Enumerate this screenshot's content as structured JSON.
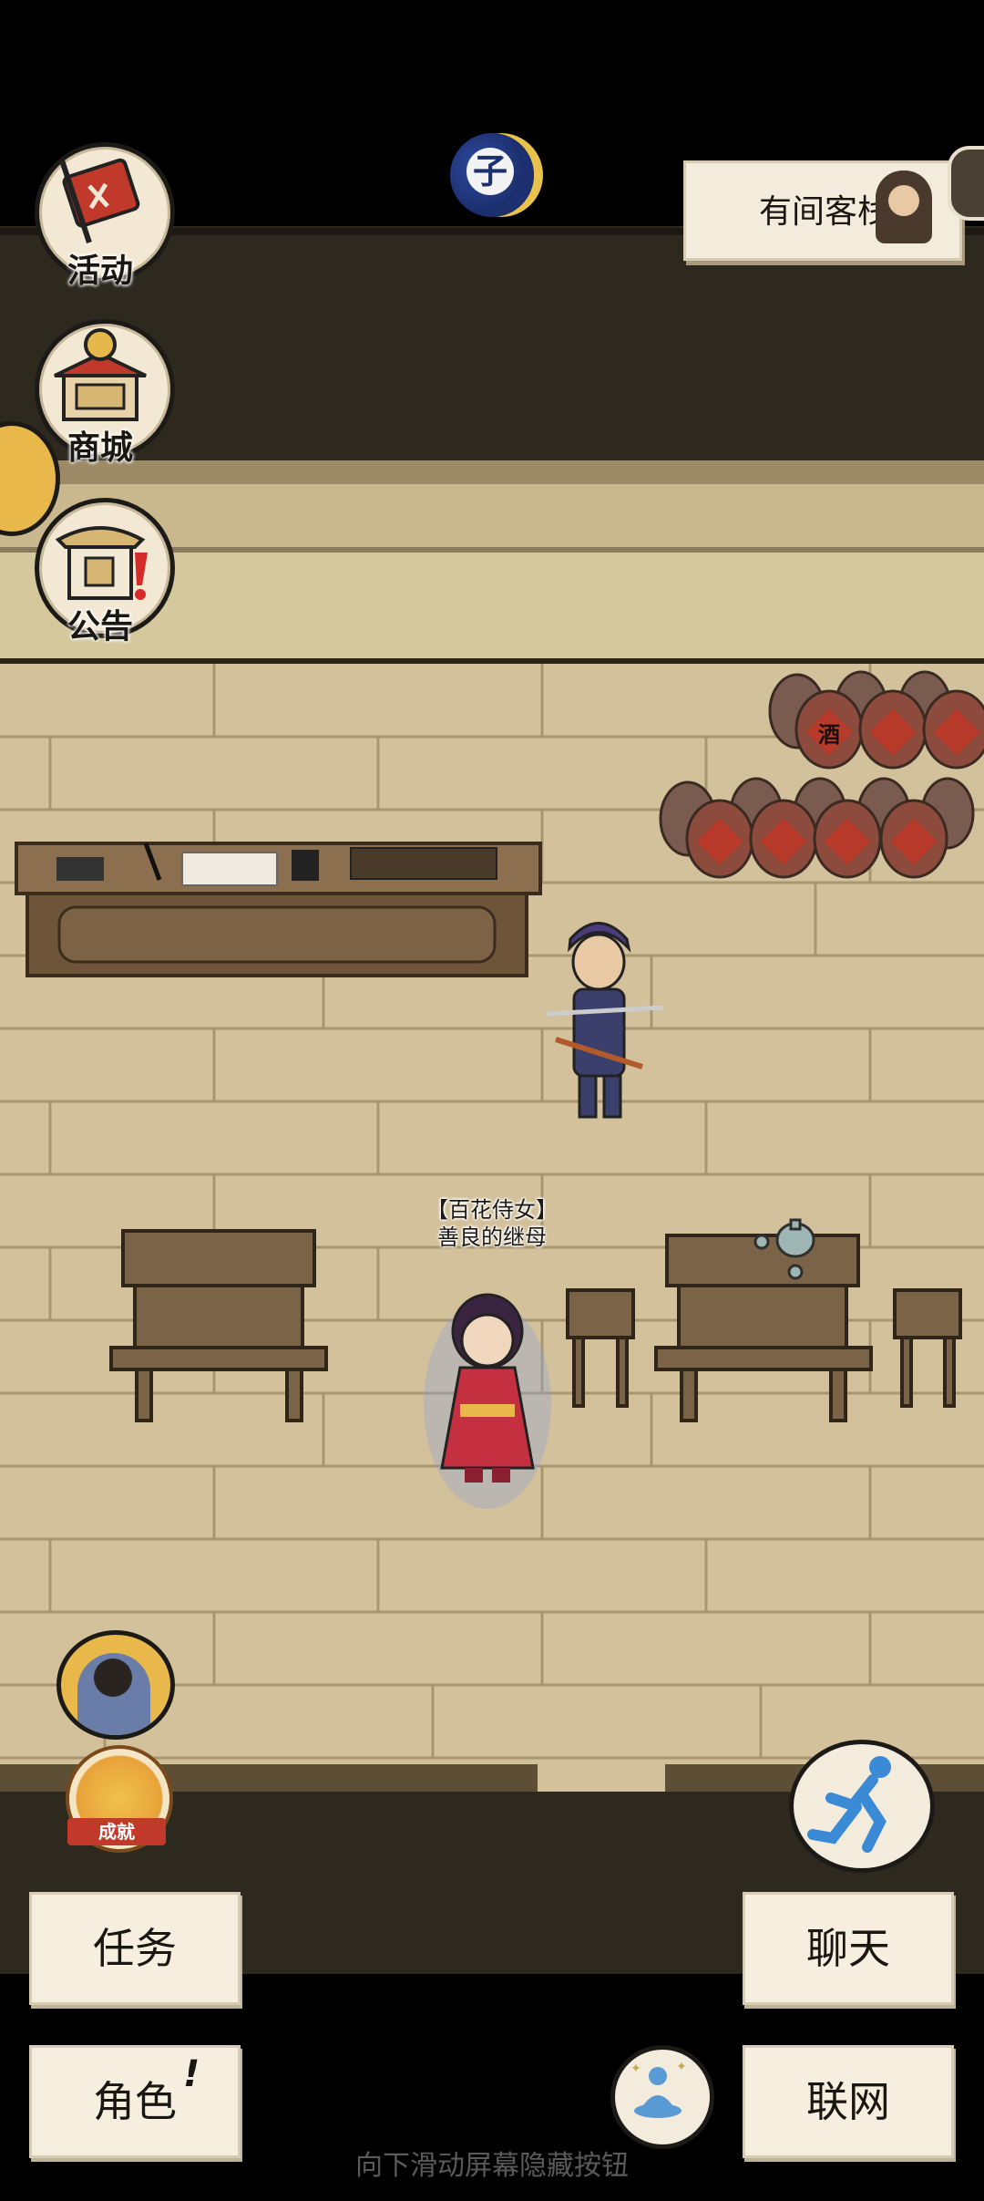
{
  "hud": {
    "time_glyph": "子",
    "location_name": "有间客栈"
  },
  "left_menu": [
    {
      "label": "活动",
      "icon": "flag-scroll-icon"
    },
    {
      "label": "商城",
      "icon": "shop-building-icon"
    },
    {
      "label": "公告",
      "icon": "announcement-board-icon"
    }
  ],
  "npc": {
    "title": "【百花侍女】",
    "name": "善良的继母"
  },
  "wine_jar_text": "酒",
  "bottom_buttons": {
    "task": "任务",
    "role": "角色",
    "role_badge": "!",
    "chat": "聊天",
    "network": "联网"
  },
  "badges": {
    "achievement": "成就"
  },
  "hint": "向下滑动屏幕隐藏按钮",
  "colors": {
    "floor": "#d3c19b",
    "wall_dark": "#2e2a1f",
    "paper": "#f6efdf",
    "jar_red": "#b83a2a"
  }
}
